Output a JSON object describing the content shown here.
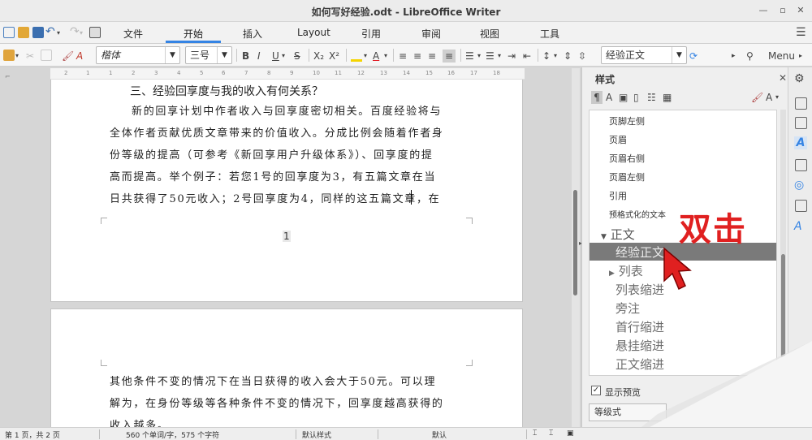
{
  "window": {
    "title": "如何写好经验.odt - LibreOffice Writer"
  },
  "tabs": [
    {
      "label": "文件"
    },
    {
      "label": "开始"
    },
    {
      "label": "插入"
    },
    {
      "label": "Layout"
    },
    {
      "label": "引用"
    },
    {
      "label": "审阅"
    },
    {
      "label": "视图"
    },
    {
      "label": "工具"
    }
  ],
  "active_tab": "开始",
  "toolbar": {
    "font_name": "楷体",
    "font_size": "三号",
    "bold": "B",
    "italic": "I",
    "underline": "U",
    "strike": "S",
    "subscript": "X₂",
    "superscript": "X²",
    "para_style": "经验正文",
    "menu_label": "Menu",
    "accent_color": "#3584e4",
    "highlight_color": "#f5d400",
    "font_color": "#e01b24"
  },
  "ruler": {
    "marks": [
      "2",
      "1",
      "1",
      "2",
      "3",
      "4",
      "5",
      "6",
      "7",
      "8",
      "9",
      "10",
      "11",
      "12",
      "13",
      "14",
      "15",
      "16",
      "17",
      "18"
    ]
  },
  "document": {
    "heading": "三、经验回享度与我的收入有何关系？",
    "page1_lines": [
      "新的回享计划中作者收入与回享度密切相关。百度经验将与",
      "全体作者贡献优质文章带来的价值收入。分成比例会随着作者身",
      "份等级的提高（可参考《新回享用户升级体系》）、回享度的提",
      "高而提高。举个例子：若您1号的回享度为3，有五篇文章在当",
      "日共获得了50元收入；2号回享度为4，同样的这五篇文章，在"
    ],
    "page1_footer": "1",
    "page2_lines": [
      "其他条件不变的情况下在当日获得的收入会大于50元。可以理",
      "解为，在身份等级等各种条件不变的情况下，回享度越高获得的",
      "收入越多。"
    ]
  },
  "sidebar": {
    "title": "样式",
    "styles_small": [
      "页脚左侧",
      "页眉",
      "页眉右侧",
      "页眉左侧",
      "引用",
      "预格式化的文本"
    ],
    "group_label": "正文",
    "selected_style": "经验正文",
    "styles_large": [
      "列表",
      "列表缩进",
      "旁注",
      "首行缩进",
      "悬挂缩进",
      "正文缩进"
    ],
    "show_preview": "显示预览",
    "hierarchy": "等级式"
  },
  "annotation": {
    "text": "双击",
    "color": "#e02020"
  },
  "statusbar": {
    "page": "第 1 页，共 2 页",
    "words": "560 个单词/字，575 个字符",
    "page_style": "默认样式",
    "language": "默认"
  }
}
